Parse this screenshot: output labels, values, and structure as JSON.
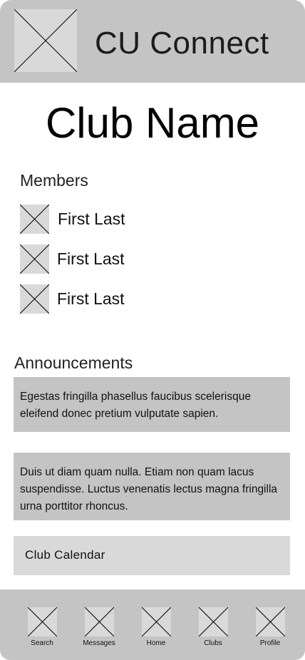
{
  "header": {
    "app_title": "CU Connect"
  },
  "club": {
    "name": "Club Name"
  },
  "members": {
    "title": "Members",
    "items": [
      {
        "name": "First Last"
      },
      {
        "name": "First Last"
      },
      {
        "name": "First Last"
      }
    ]
  },
  "announcements": {
    "title": "Announcements",
    "items": [
      {
        "text": "Egestas fringilla phasellus faucibus scelerisque eleifend donec pretium vulputate sapien."
      },
      {
        "text": "Duis ut diam quam nulla. Etiam non quam lacus suspendisse. Luctus venenatis lectus magna fringilla urna porttitor rhoncus."
      }
    ]
  },
  "calendar": {
    "label": "Club Calendar"
  },
  "nav": {
    "items": [
      {
        "label": "Search"
      },
      {
        "label": "Messages"
      },
      {
        "label": "Home"
      },
      {
        "label": "Clubs"
      },
      {
        "label": "Profile"
      }
    ]
  }
}
